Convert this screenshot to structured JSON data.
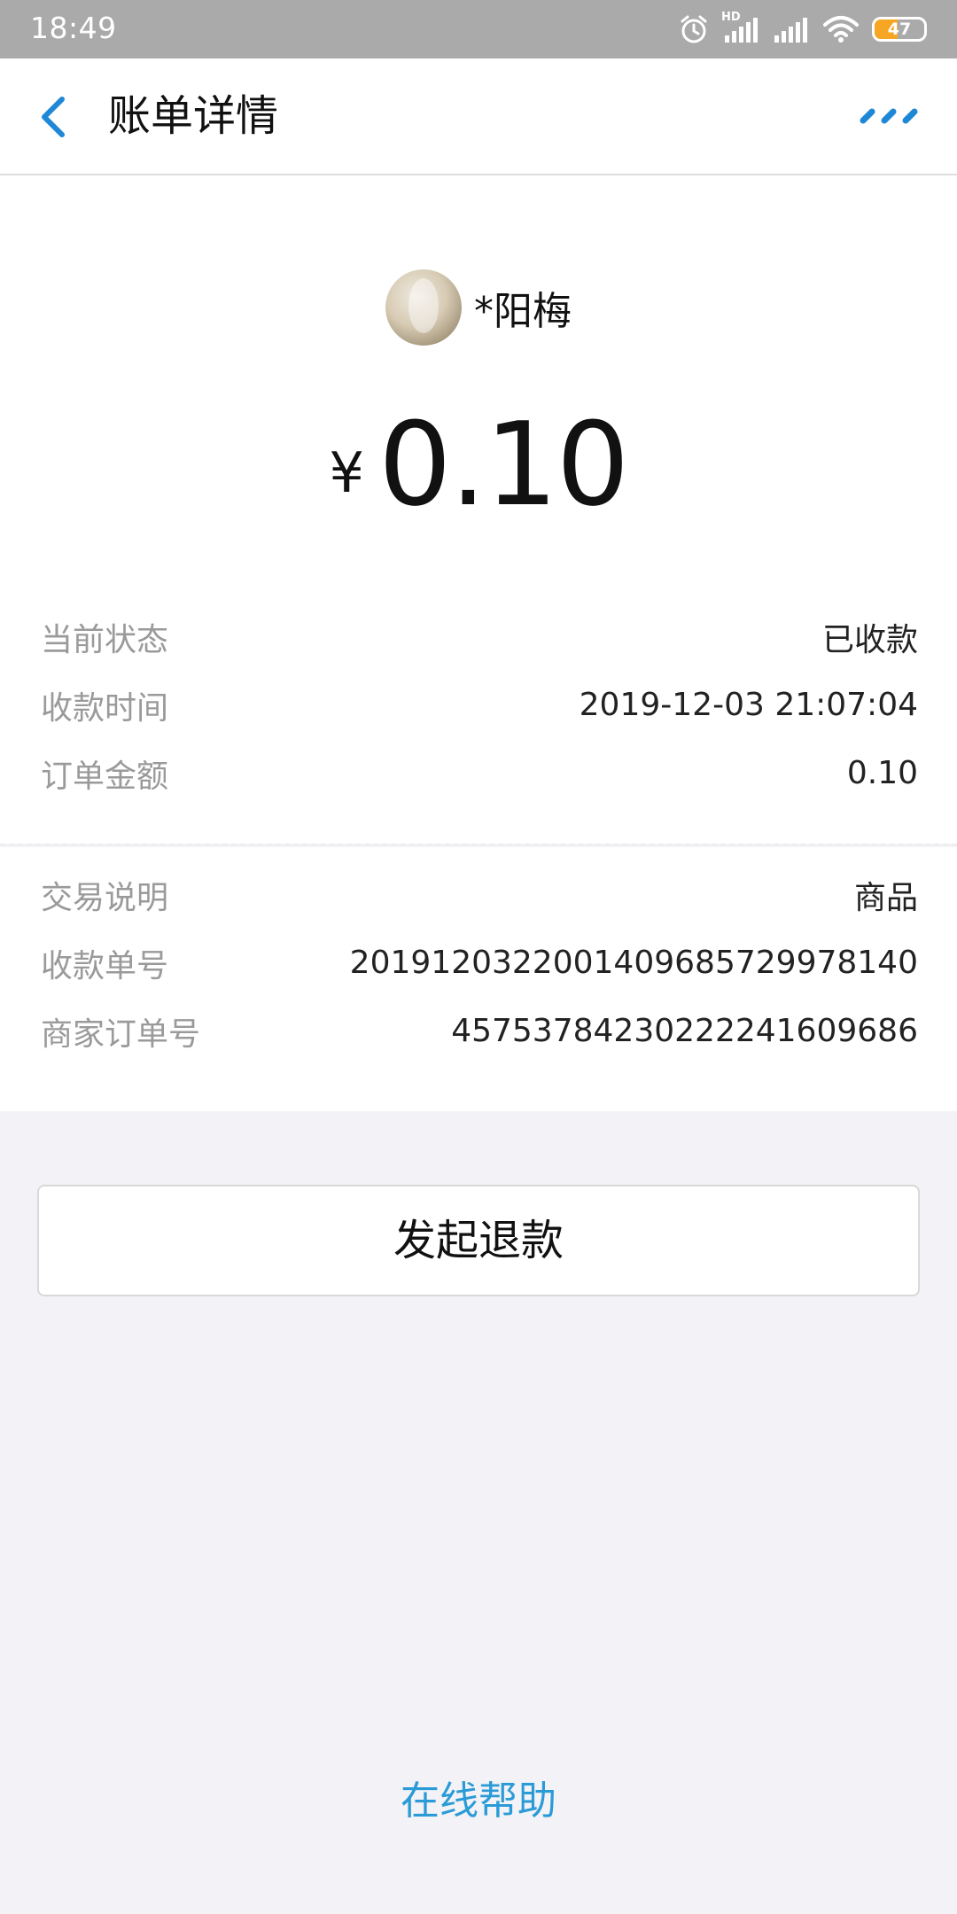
{
  "status_bar": {
    "time": "18:49",
    "battery_level": "47",
    "battery_fraction": 0.47,
    "network_label": "HD",
    "icons": [
      "alarm-icon",
      "signal-hd-icon",
      "signal-icon",
      "wifi-icon",
      "battery-icon"
    ]
  },
  "nav": {
    "title": "账单详情",
    "back_icon": "chevron-left-icon",
    "more_icon": "more-dots-icon",
    "accent_color": "#1e88d6"
  },
  "payer": {
    "name": "*阳梅",
    "avatar": "avatar-photo"
  },
  "amount": {
    "currency": "¥",
    "value": "0.10"
  },
  "details_top": [
    {
      "label": "当前状态",
      "value": "已收款"
    },
    {
      "label": "收款时间",
      "value": "2019-12-03 21:07:04"
    },
    {
      "label": "订单金额",
      "value": "0.10"
    }
  ],
  "details_bottom": [
    {
      "label": "交易说明",
      "value": "商品"
    },
    {
      "label": "收款单号",
      "value": "2019120322001409685729978140"
    },
    {
      "label": "商家订单号",
      "value": "4575378423022224160968​6"
    }
  ],
  "actions": {
    "refund_label": "发起退款"
  },
  "footer": {
    "help_label": "在线帮助",
    "link_color": "#2a9bd6"
  }
}
